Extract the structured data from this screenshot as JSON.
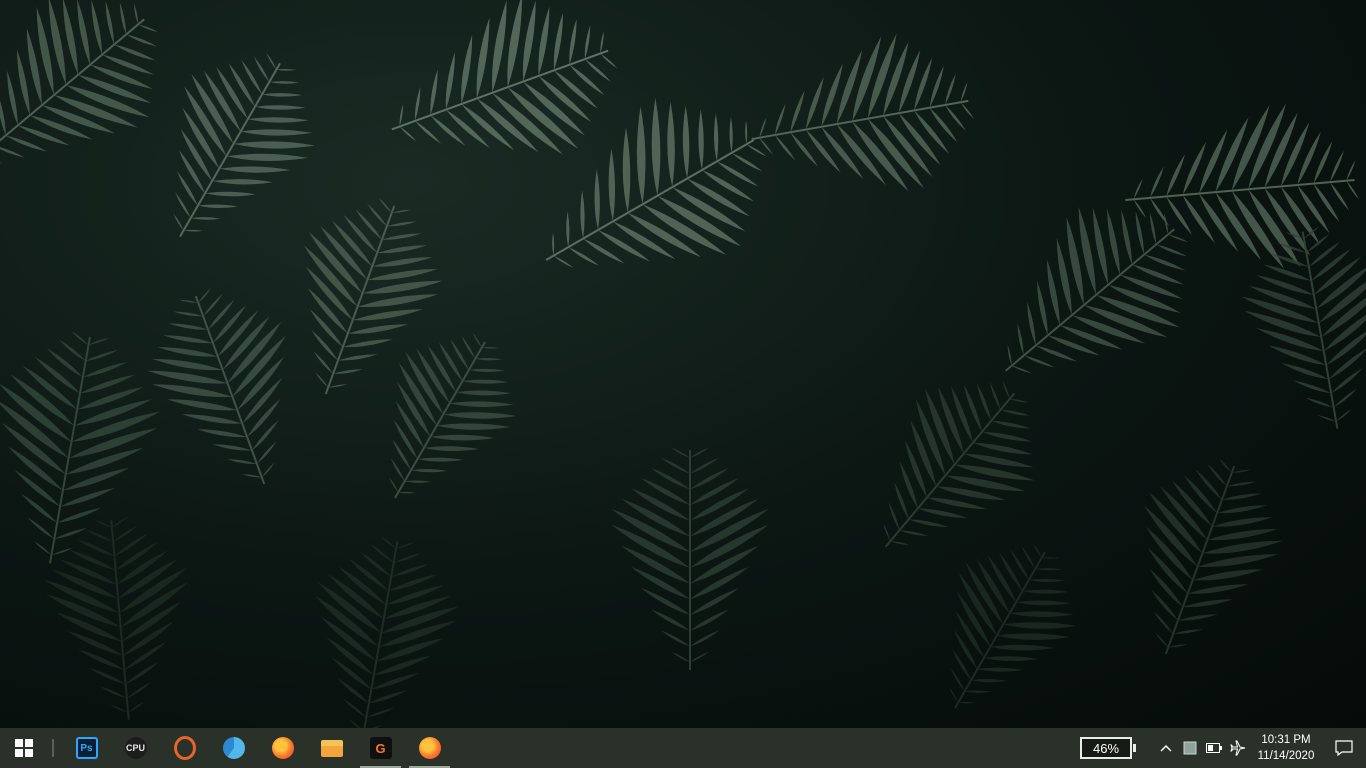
{
  "desktop": {
    "wallpaper": "dark-palm-leaves"
  },
  "taskbar": {
    "start_icon": "windows-logo-icon",
    "pinned_apps": [
      {
        "name": "photoshop",
        "glyph": "Ps",
        "icon": "photoshop-icon",
        "running": false
      },
      {
        "name": "cpuid",
        "glyph": "CPU",
        "icon": "cpuid-icon",
        "running": false
      },
      {
        "name": "opera",
        "glyph": "",
        "icon": "opera-icon",
        "running": false
      },
      {
        "name": "edge",
        "glyph": "",
        "icon": "edge-icon",
        "running": false
      },
      {
        "name": "firefox",
        "glyph": "",
        "icon": "firefox-icon",
        "running": false
      },
      {
        "name": "file-explorer",
        "glyph": "",
        "icon": "folder-icon",
        "running": false
      },
      {
        "name": "garena",
        "glyph": "G",
        "icon": "garena-icon",
        "running": true
      },
      {
        "name": "firefox-2",
        "glyph": "",
        "icon": "firefox-icon",
        "running": true
      }
    ]
  },
  "tray": {
    "battery_percent": "46%",
    "show_hidden_icon": "chevron-up-icon",
    "network_icon": "network-icon",
    "battery_icon": "battery-icon",
    "airplane_icon": "airplane-mode-icon",
    "time": "10:31 PM",
    "date": "11/14/2020",
    "notifications_icon": "action-center-icon"
  },
  "colors": {
    "taskbar": "#2a3129",
    "accent_line": "#9aa79a"
  }
}
